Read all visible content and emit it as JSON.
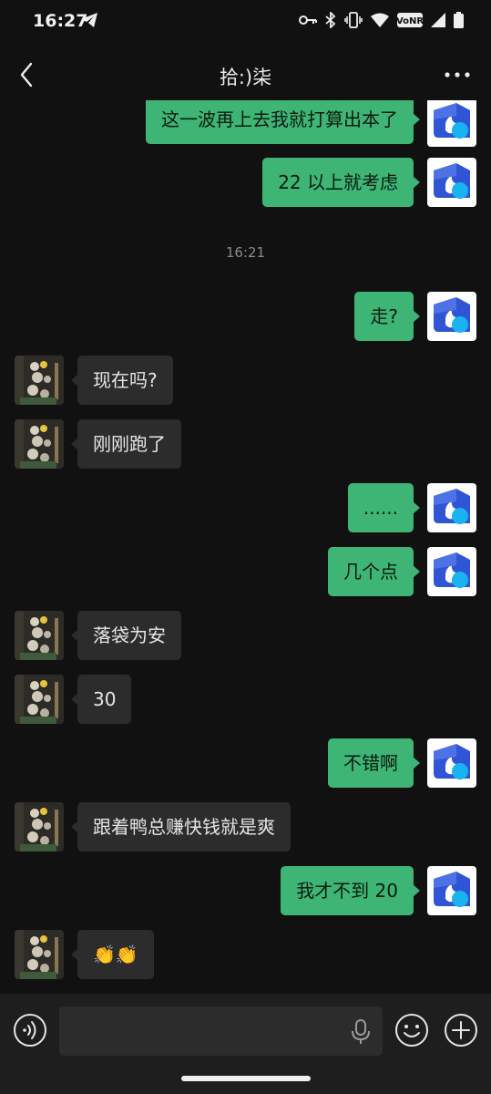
{
  "status_bar": {
    "time": "16:27",
    "icons": [
      "telegram-icon",
      "key-icon",
      "bluetooth-icon",
      "vibrate-icon",
      "wifi-icon",
      "volte-icon",
      "signal-icon",
      "battery-icon"
    ],
    "volte_label": "VoNR"
  },
  "header": {
    "title": "拾:)柒",
    "back_icon": "chevron-left-icon",
    "more_icon": "more-icon"
  },
  "messages": [
    {
      "sender": "me",
      "text": "这一波再上去我就打算出本了"
    },
    {
      "sender": "me",
      "text": "22 以上就考虑"
    },
    {
      "type": "timestamp",
      "text": "16:21"
    },
    {
      "sender": "me",
      "text": "走?"
    },
    {
      "sender": "other",
      "text": "现在吗?"
    },
    {
      "sender": "other",
      "text": "刚刚跑了"
    },
    {
      "sender": "me",
      "text": "......"
    },
    {
      "sender": "me",
      "text": "几个点"
    },
    {
      "sender": "other",
      "text": "落袋为安"
    },
    {
      "sender": "other",
      "text": "30"
    },
    {
      "sender": "me",
      "text": "不错啊"
    },
    {
      "sender": "other",
      "text": "跟着鸭总赚快钱就是爽"
    },
    {
      "sender": "me",
      "text": "我才不到 20"
    },
    {
      "sender": "other",
      "text": "👏👏"
    }
  ],
  "input_bar": {
    "voice_icon": "voice-toggle-icon",
    "mic_icon": "mic-icon",
    "emoji_icon": "emoji-icon",
    "plus_icon": "plus-icon",
    "placeholder": ""
  },
  "colors": {
    "background": "#111111",
    "my_bubble": "#3eb575",
    "their_bubble": "#2c2c2c",
    "input_bar": "#1e1e1e",
    "avatar_blue": "#2f55d4"
  }
}
